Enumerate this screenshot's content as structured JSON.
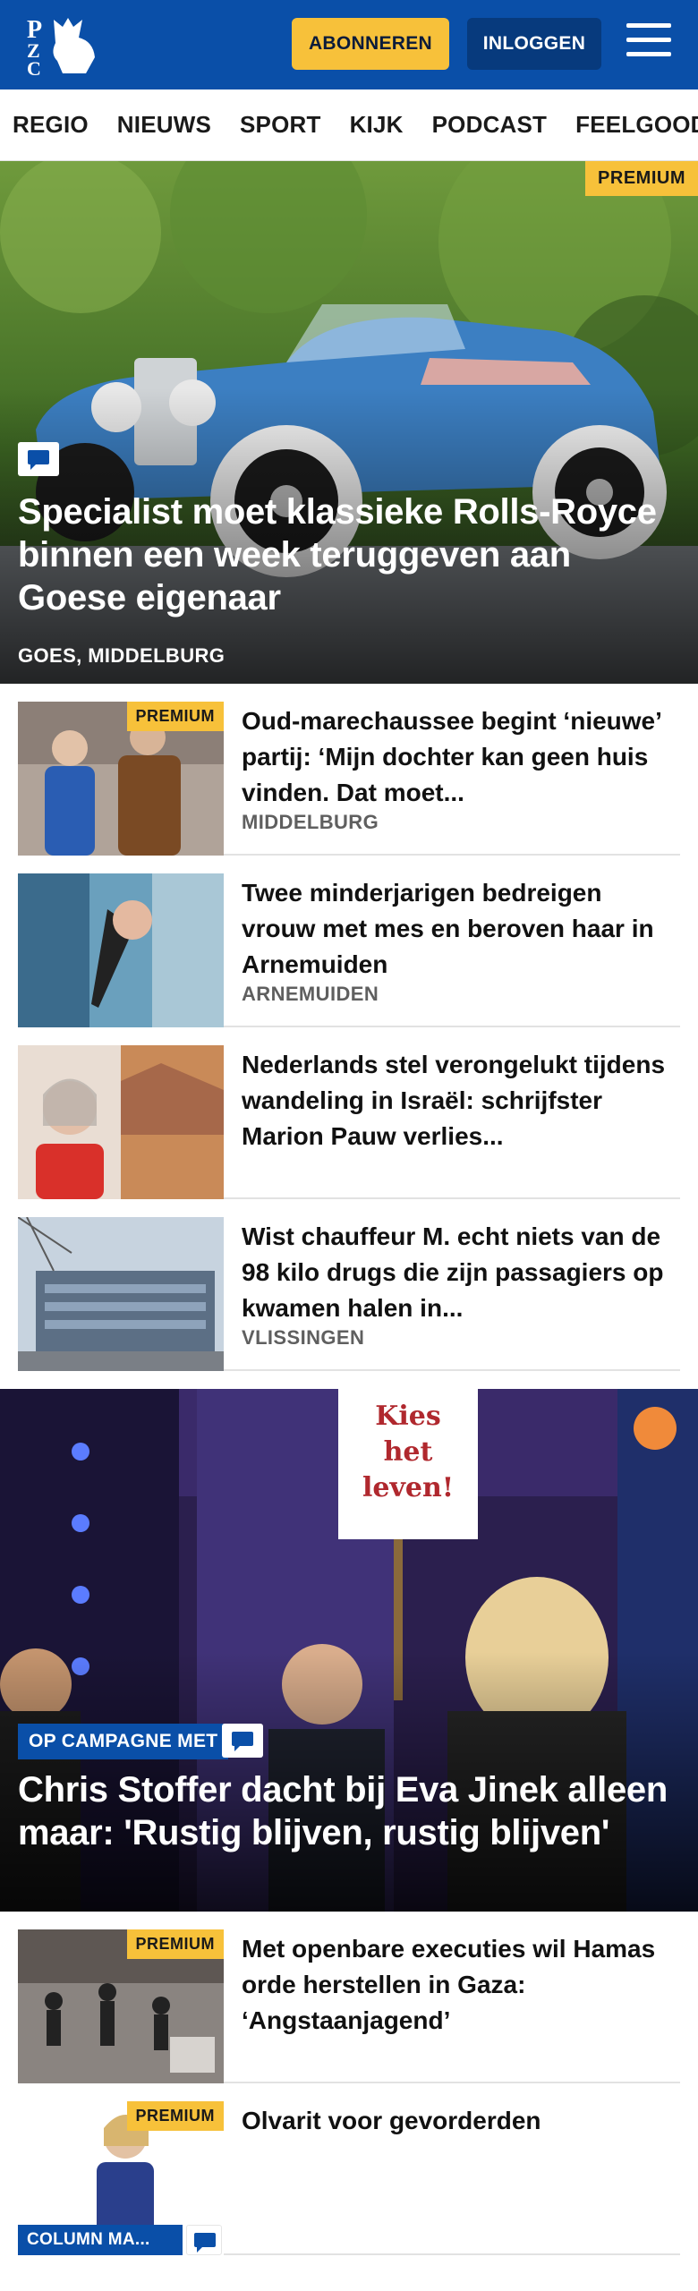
{
  "header": {
    "logo_text": "PZC",
    "subscribe_label": "ABONNEREN",
    "login_label": "INLOGGEN",
    "menu_icon": "hamburger-menu-icon",
    "brand_color": "#0a4fa8",
    "accent_color": "#f7c13a"
  },
  "nav": {
    "items": [
      "REGIO",
      "NIEUWS",
      "SPORT",
      "KIJK",
      "PODCAST",
      "FEELGOOD"
    ]
  },
  "hero": {
    "badge": "PREMIUM",
    "title": "Specialist moet klassieke Rolls-Royce binnen een week teruggeven aan Goese eigenaar",
    "location": "GOES, MIDDELBURG"
  },
  "articles": [
    {
      "badge": "PREMIUM",
      "title": "Oud-marechaussee begint ‘nieuwe’ partij: ‘Mijn dochter kan geen huis vinden. Dat moet...",
      "location": "MIDDELBURG"
    },
    {
      "title": "Twee minderjarigen bedreigen vrouw met mes en beroven haar in Arnemuiden",
      "location": "ARNEMUIDEN"
    },
    {
      "title": "Nederlands stel verongelukt tijdens wandeling in Israël: schrijfster Marion Pauw verlies...",
      "location": ""
    },
    {
      "title": "Wist chauffeur M. echt niets van de 98 kilo drugs die zijn passagiers op kwamen halen in...",
      "location": "VLISSINGEN"
    }
  ],
  "hero2": {
    "category": "OP CAMPAGNE MET",
    "sign_text": "Kies het leven!",
    "title": "Chris Stoffer dacht bij Eva Jinek alleen maar: 'Rustig blijven, rustig blijven'"
  },
  "articles2": [
    {
      "badge": "PREMIUM",
      "title": "Met openbare executies wil Hamas orde herstellen in Gaza: ‘Angstaanjagend’"
    },
    {
      "badge": "PREMIUM",
      "title": "Olvarit voor gevorderden",
      "category": "COLUMN MA..."
    }
  ]
}
